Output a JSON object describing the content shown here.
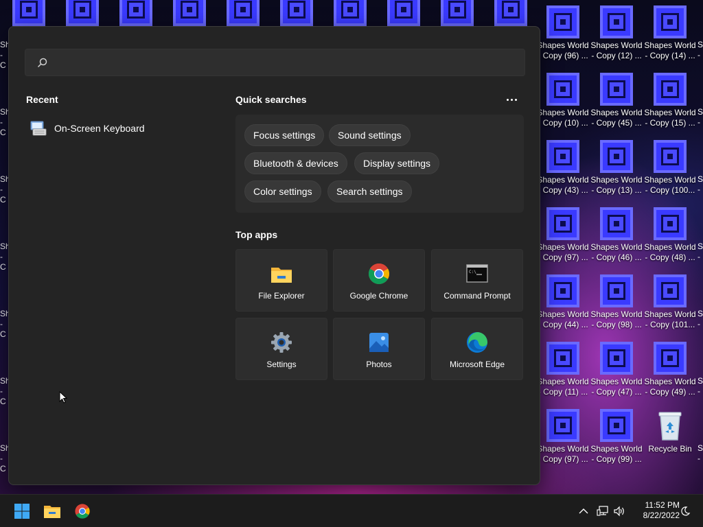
{
  "desktop": {
    "icons": [
      {
        "line1": "Shapes World",
        "line2": "- Copy (96) ..."
      },
      {
        "line1": "Shapes World",
        "line2": "- Copy (12) ..."
      },
      {
        "line1": "Shapes World",
        "line2": "- Copy (14) ..."
      },
      {
        "line1": "Shapes World",
        "line2": "- Copy (10) ..."
      },
      {
        "line1": "Shapes World",
        "line2": "- Copy (45) ..."
      },
      {
        "line1": "Shapes World",
        "line2": "- Copy (15) ..."
      },
      {
        "line1": "Shapes World",
        "line2": "- Copy (43) ..."
      },
      {
        "line1": "Shapes World",
        "line2": "- Copy (13) ..."
      },
      {
        "line1": "Shapes World",
        "line2": "- Copy (100..."
      },
      {
        "line1": "Shapes World",
        "line2": "- Copy (97) ..."
      },
      {
        "line1": "Shapes World",
        "line2": "- Copy (46) ..."
      },
      {
        "line1": "Shapes World",
        "line2": "- Copy (48) ..."
      },
      {
        "line1": "Shapes World",
        "line2": "- Copy (44) ..."
      },
      {
        "line1": "Shapes World",
        "line2": "- Copy (98) ..."
      },
      {
        "line1": "Shapes World",
        "line2": "- Copy (101..."
      },
      {
        "line1": "Shapes World",
        "line2": "- Copy (11) ..."
      },
      {
        "line1": "Shapes World",
        "line2": "- Copy (47) ..."
      },
      {
        "line1": "Shapes World",
        "line2": "- Copy (49) ..."
      },
      {
        "line1": "Shapes World",
        "line2": "- Copy (97) ..."
      },
      {
        "line1": "Shapes World",
        "line2": "- Copy (99) ..."
      }
    ],
    "recycle_bin_label": "Recycle Bin",
    "edge_fragment_left_1": "Sh",
    "edge_fragment_left_2": "- C",
    "edge_fragment_right_1": "S",
    "edge_fragment_right_2": "-"
  },
  "start_menu": {
    "search": {
      "placeholder": "",
      "value": ""
    },
    "recent": {
      "title": "Recent",
      "items": [
        {
          "label": "On-Screen Keyboard",
          "icon": "keyboard-icon"
        }
      ]
    },
    "quick_searches": {
      "title": "Quick searches",
      "chips": [
        "Focus settings",
        "Sound settings",
        "Bluetooth & devices",
        "Display settings",
        "Color settings",
        "Search settings"
      ]
    },
    "top_apps": {
      "title": "Top apps",
      "apps": [
        {
          "label": "File Explorer",
          "icon": "file-explorer-icon"
        },
        {
          "label": "Google Chrome",
          "icon": "chrome-icon"
        },
        {
          "label": "Command Prompt",
          "icon": "command-prompt-icon"
        },
        {
          "label": "Settings",
          "icon": "settings-gear-icon"
        },
        {
          "label": "Photos",
          "icon": "photos-icon"
        },
        {
          "label": "Microsoft Edge",
          "icon": "edge-icon"
        }
      ]
    }
  },
  "taskbar": {
    "time": "11:52 PM",
    "date": "8/22/2022",
    "pinned": [
      "windows-start-icon",
      "file-explorer-icon",
      "chrome-icon"
    ]
  },
  "colors": {
    "menu_bg": "#242424",
    "taskbar_bg": "#1c1c1c",
    "desktop_icon": "#3a3aff"
  }
}
